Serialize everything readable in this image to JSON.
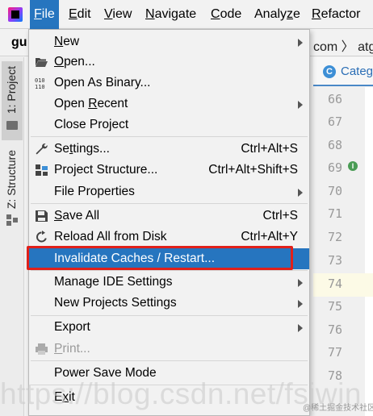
{
  "menubar": {
    "items": [
      {
        "pre": "",
        "mn": "F",
        "post": "ile"
      },
      {
        "pre": "",
        "mn": "E",
        "post": "dit"
      },
      {
        "pre": "",
        "mn": "V",
        "post": "iew"
      },
      {
        "pre": "",
        "mn": "N",
        "post": "avigate"
      },
      {
        "pre": "",
        "mn": "C",
        "post": "ode"
      },
      {
        "pre": "Analy",
        "mn": "z",
        "post": "e"
      },
      {
        "pre": "",
        "mn": "R",
        "post": "efactor"
      }
    ]
  },
  "background": {
    "project_short": "gu",
    "breadcrumb": "com 〉 atg",
    "tab_icon_letter": "C",
    "tab_label": "Categ",
    "line_numbers": [
      "66",
      "67",
      "68",
      "69",
      "70",
      "71",
      "72",
      "73",
      "74",
      "75",
      "76",
      "77",
      "78"
    ],
    "implement_icon": "I",
    "stripe_project": "1: Project",
    "stripe_structure": "Z: Structure"
  },
  "file_menu": {
    "items": [
      {
        "pre": "",
        "mn": "N",
        "post": "ew",
        "shortcut": "",
        "submenu": true,
        "icon": ""
      },
      {
        "pre": "",
        "mn": "O",
        "post": "pen...",
        "shortcut": "",
        "submenu": false,
        "icon": "folder-open-icon"
      },
      {
        "pre": "Open As Binary...",
        "mn": "",
        "post": "",
        "shortcut": "",
        "submenu": false,
        "icon": "binary-icon"
      },
      {
        "pre": "Open ",
        "mn": "R",
        "post": "ecent",
        "shortcut": "",
        "submenu": true,
        "icon": ""
      },
      {
        "pre": "Close Project",
        "mn": "",
        "post": "",
        "shortcut": "",
        "submenu": false,
        "icon": ""
      },
      {
        "pre": "Se",
        "mn": "t",
        "post": "tings...",
        "shortcut": "Ctrl+Alt+S",
        "submenu": false,
        "icon": "wrench-icon"
      },
      {
        "pre": "Project Structure...",
        "mn": "",
        "post": "",
        "shortcut": "Ctrl+Alt+Shift+S",
        "submenu": false,
        "icon": "project-structure-icon"
      },
      {
        "pre": "File Properties",
        "mn": "",
        "post": "",
        "shortcut": "",
        "submenu": true,
        "icon": ""
      },
      {
        "pre": "",
        "mn": "S",
        "post": "ave All",
        "shortcut": "Ctrl+S",
        "submenu": false,
        "icon": "save-icon"
      },
      {
        "pre": "Reload All from Disk",
        "mn": "",
        "post": "",
        "shortcut": "Ctrl+Alt+Y",
        "submenu": false,
        "icon": "reload-icon"
      },
      {
        "pre": "Invalidate Caches / Restart...",
        "mn": "",
        "post": "",
        "shortcut": "",
        "submenu": false,
        "icon": ""
      },
      {
        "pre": "Manage IDE Settings",
        "mn": "",
        "post": "",
        "shortcut": "",
        "submenu": true,
        "icon": ""
      },
      {
        "pre": "New Projects Settings",
        "mn": "",
        "post": "",
        "shortcut": "",
        "submenu": true,
        "icon": ""
      },
      {
        "pre": "Export",
        "mn": "",
        "post": "",
        "shortcut": "",
        "submenu": true,
        "icon": ""
      },
      {
        "pre": "",
        "mn": "P",
        "post": "rint...",
        "shortcut": "",
        "submenu": false,
        "icon": "print-icon"
      },
      {
        "pre": "Power Save Mode",
        "mn": "",
        "post": "",
        "shortcut": "",
        "submenu": false,
        "icon": ""
      },
      {
        "pre": "E",
        "mn": "x",
        "post": "it",
        "shortcut": "",
        "submenu": false,
        "icon": ""
      }
    ],
    "highlighted_index": 10,
    "disabled_index": 14
  },
  "watermark": {
    "url": "https://blog.csdn.net/fsjwin",
    "credit": "@稀土掘金技术社区"
  },
  "colors": {
    "highlight": "#2675bf",
    "annotation_box": "#e0201a"
  }
}
